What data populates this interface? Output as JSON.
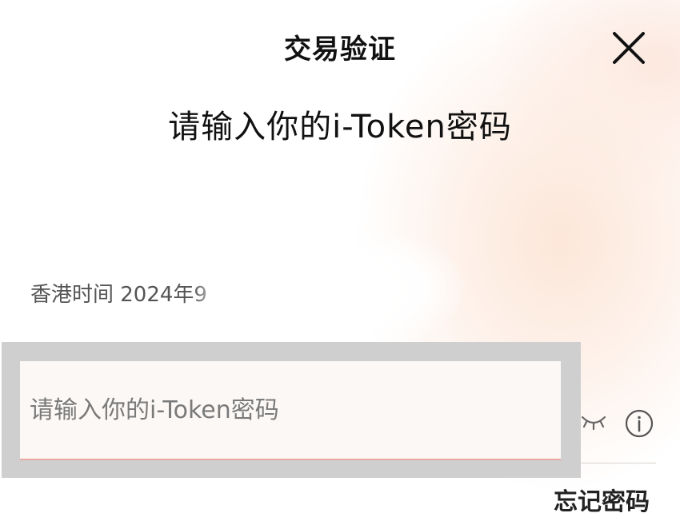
{
  "dialog": {
    "title": "交易验证",
    "close_icon": "close-icon"
  },
  "prompt": {
    "heading": "请输入你的i-Token密码"
  },
  "timestamp": {
    "text": "香港时间 2024年9"
  },
  "password": {
    "placeholder": "请输入你的i-Token密码",
    "value": ""
  },
  "icons": {
    "visibility": "eye-closed-icon",
    "info": "info-icon"
  },
  "actions": {
    "forgot_password": "忘记密码"
  },
  "colors": {
    "field_underline": "#e7a9a0",
    "overlay": "#cfcfcf",
    "text_primary": "#111111",
    "text_secondary": "#555555"
  }
}
